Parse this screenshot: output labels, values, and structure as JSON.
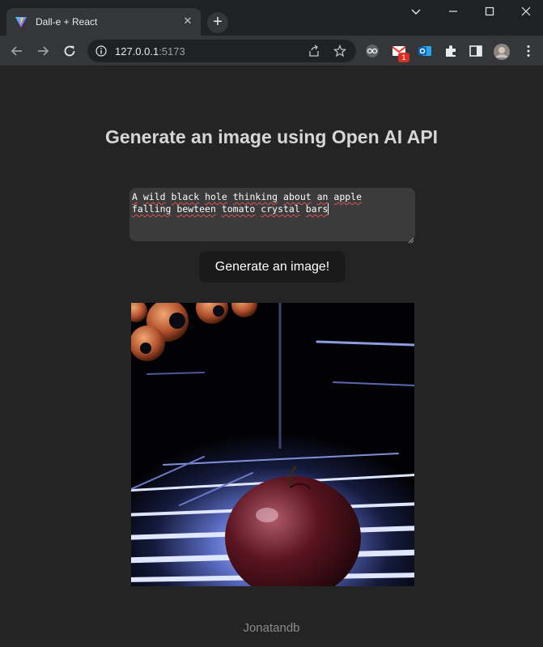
{
  "browser": {
    "tab_title": "Dall-e + React",
    "url_host": "127.0.0.1",
    "url_port": ":5173",
    "mail_badge": "1"
  },
  "app": {
    "title": "Generate an image using Open AI API",
    "prompt_line1": "A wild black hole thinking about an apple",
    "prompt_line2": "falling bewteen tomato crystal bars",
    "generate_label": "Generate an image!",
    "footer": "Jonatandb"
  },
  "colors": {
    "background": "#242424",
    "textarea": "#3b3b3b",
    "button": "#1a1a1a"
  },
  "icons": {
    "favicon": "vite-logo-icon",
    "back": "arrow-left-icon",
    "forward": "arrow-right-icon",
    "reload": "reload-icon",
    "site_info": "info-icon",
    "share": "share-icon",
    "bookmark": "star-icon",
    "extensions": "puzzle-icon"
  }
}
